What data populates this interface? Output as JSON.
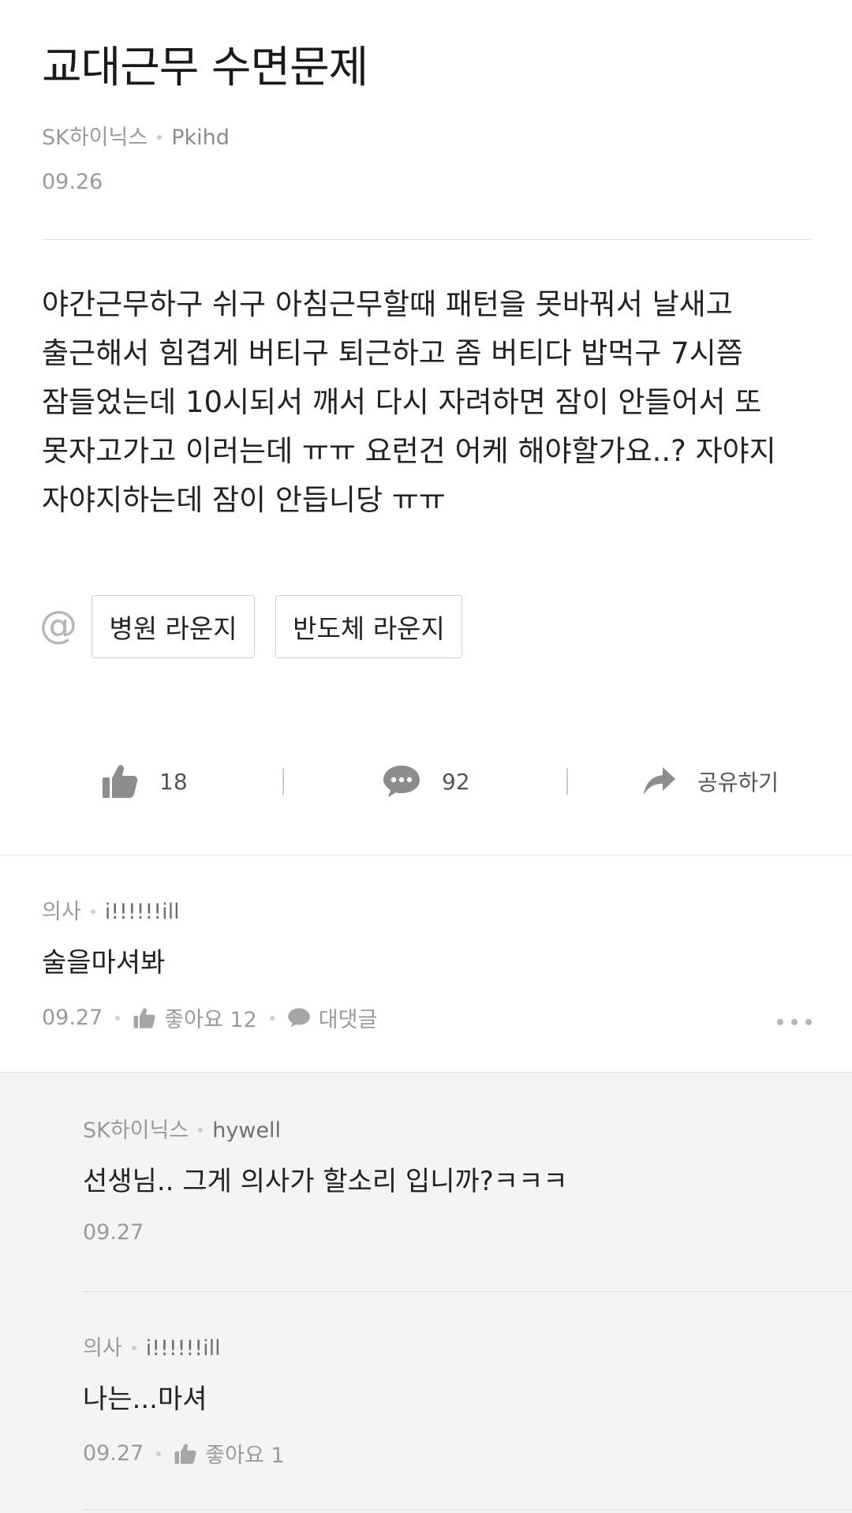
{
  "post": {
    "title": "교대근무 수면문제",
    "company": "SK하이닉스",
    "nickname": "Pkihd",
    "date": "09.26",
    "body_lines": [
      "야간근무하구 쉬구 아침근무할때 패턴을 못바꿔서 날새고",
      "출근해서 힘겹게 버티구 퇴근하고 좀 버티다 밥먹구 7시쯤",
      "잠들었는데 10시되서 깨서 다시 자려하면 잠이 안들어서 또",
      "못자고가고 이러는데 ㅠㅠ 요런건 어케 해야할가요..? 자야지",
      "자야지하는데 잠이 안듭니당 ㅠㅠ"
    ],
    "tags": [
      "병원 라운지",
      "반도체 라운지"
    ]
  },
  "actions": {
    "likes": "18",
    "comments": "92",
    "share_label": "공유하기"
  },
  "comments": [
    {
      "company": "의사",
      "nickname": "i!!!!!!ill",
      "text": "술을마셔봐",
      "date": "09.27",
      "like_label": "좋아요 12",
      "reply_label": "대댓글"
    }
  ],
  "replies": [
    {
      "company": "SK하이닉스",
      "nickname": "hywell",
      "text": "선생님.. 그게 의사가 할소리 입니까?ㅋㅋㅋ",
      "date": "09.27"
    },
    {
      "company": "의사",
      "nickname": "i!!!!!!ill",
      "text": "나는...마셔",
      "date": "09.27",
      "like_label": "좋아요 1"
    }
  ],
  "icons": {
    "at": "at-icon",
    "like": "thumbs-up-icon",
    "comment": "speech-bubble-icon",
    "share": "share-arrow-icon",
    "more": "more-dots-icon"
  },
  "colors": {
    "text": "#222222",
    "muted": "#9a9a9a",
    "icon": "#8c8c8c",
    "reply_bg": "#f4f4f4"
  }
}
